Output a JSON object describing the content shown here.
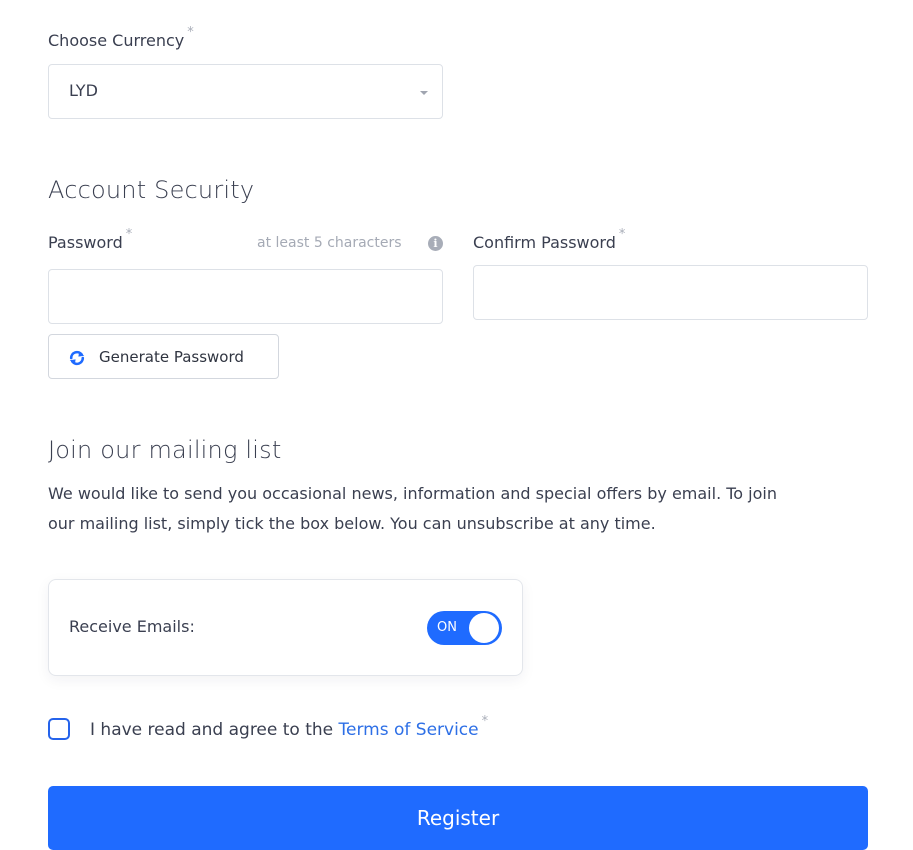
{
  "currency": {
    "label": "Choose Currency",
    "required_mark": "*",
    "selected": "LYD"
  },
  "security": {
    "heading": "Account Security",
    "password_label": "Password",
    "password_required_mark": "*",
    "password_hint": "at least 5 characters",
    "password_value": "",
    "confirm_label": "Confirm Password",
    "confirm_required_mark": "*",
    "confirm_value": "",
    "generate_label": "Generate Password"
  },
  "mailing": {
    "heading": "Join our mailing list",
    "description_line1": "We would like to send you occasional news, information and special offers by email. To join",
    "description_line2": "our mailing list, simply tick the box below. You can unsubscribe at any time.",
    "receive_label": "Receive Emails:",
    "toggle_state": "ON"
  },
  "terms": {
    "checked": false,
    "prefix": "I have read and agree to the ",
    "link_text": "Terms of Service",
    "required_mark": "*"
  },
  "register_label": "Register",
  "colors": {
    "accent": "#1f6bff",
    "link": "#2d6fe6",
    "text": "#3a3f50",
    "muted": "#a5aab5"
  }
}
